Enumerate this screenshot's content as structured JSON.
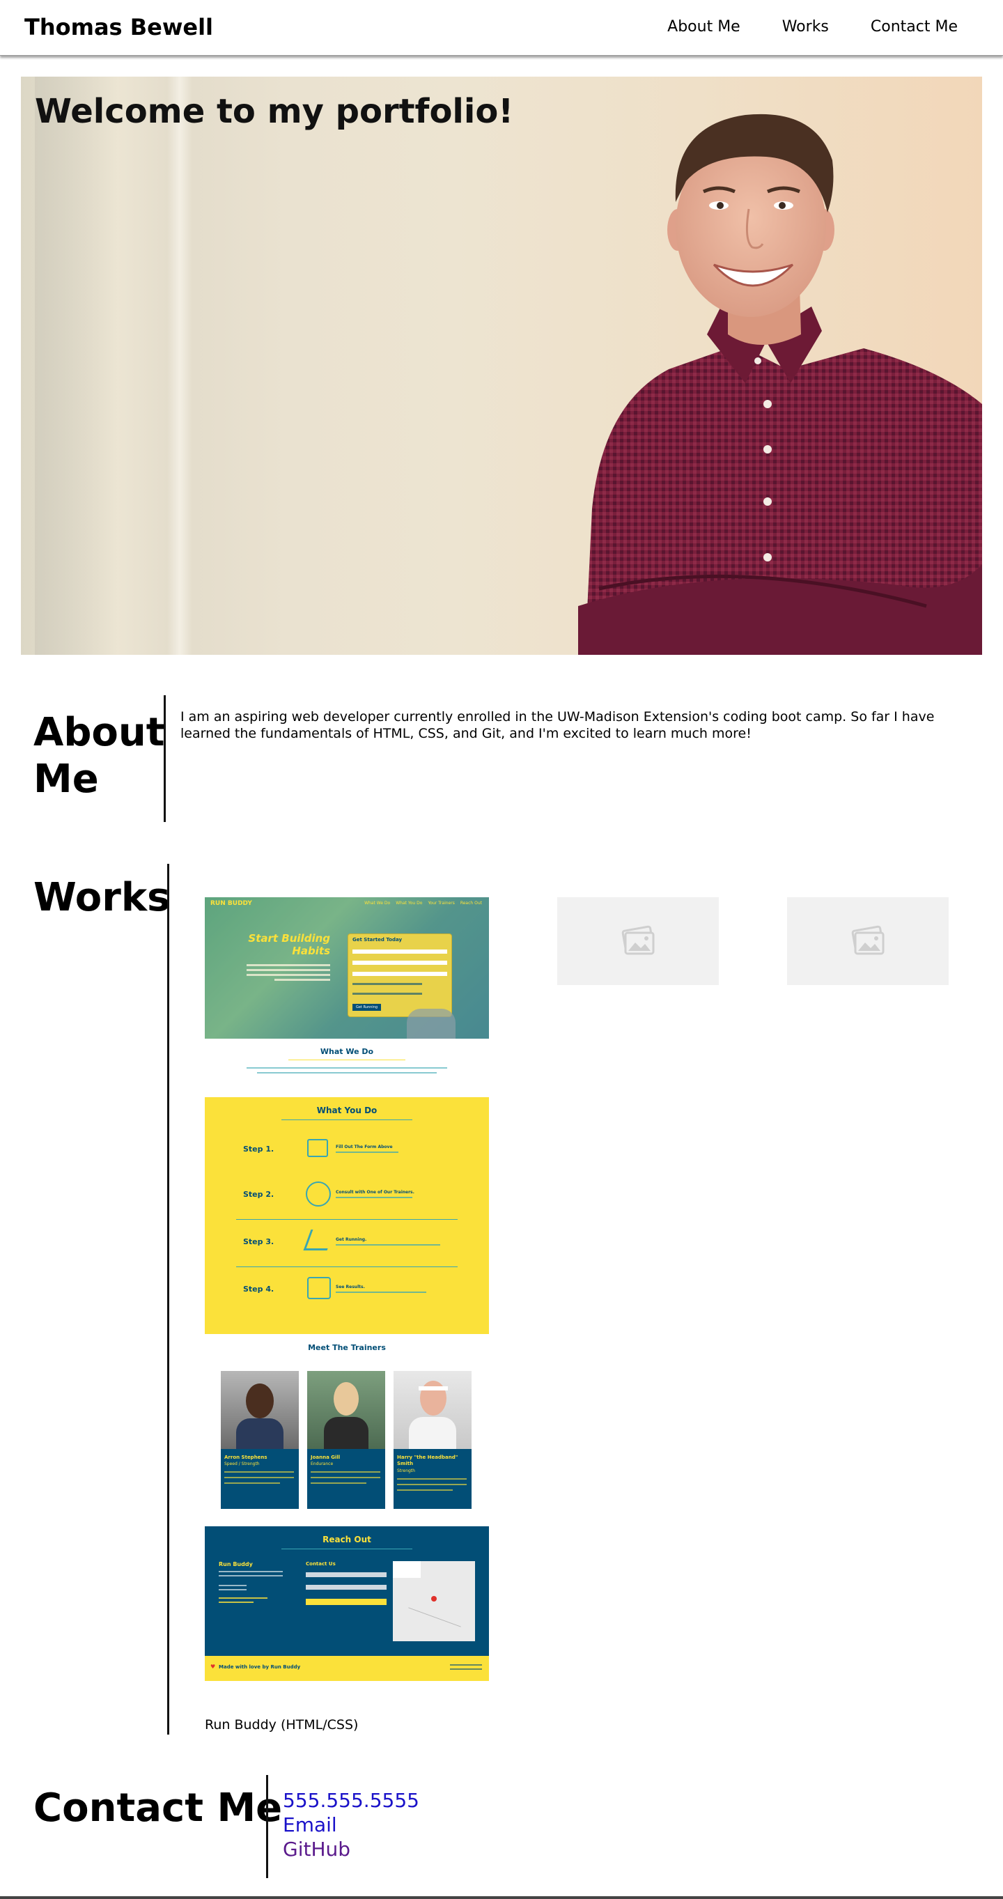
{
  "header": {
    "brand": "Thomas Bewell",
    "nav": [
      "About Me",
      "Works",
      "Contact Me"
    ]
  },
  "hero": {
    "title": "Welcome to my portfolio!"
  },
  "about": {
    "title_line1": "About",
    "title_line2": "Me",
    "text": "I am an aspiring web developer currently enrolled in the UW-Madison Extension's coding boot camp. So far I have learned the fundamentals of HTML, CSS, and Git, and I'm excited to learn much more!"
  },
  "works": {
    "title": "Works",
    "caption": "Run Buddy (HTML/CSS)",
    "screenshot": {
      "logo": "RUN BUDDY",
      "nav": [
        "What We Do",
        "What You Do",
        "Your Trainers",
        "Reach Out"
      ],
      "hero_heading_1": "Start Building",
      "hero_heading_2": "Habits",
      "form_title": "Get Started Today",
      "form_button": "Get Running",
      "what_we_do": "What We Do",
      "what_you_do": "What You Do",
      "steps": [
        {
          "label": "Step 1.",
          "title": "Fill Out The Form Above"
        },
        {
          "label": "Step 2.",
          "title": "Consult with One of Our Trainers."
        },
        {
          "label": "Step 3.",
          "title": "Get Running."
        },
        {
          "label": "Step 4.",
          "title": "See Results."
        }
      ],
      "trainers_title": "Meet The Trainers",
      "trainers": [
        {
          "name": "Arron Stephens",
          "role": "Speed / Strength"
        },
        {
          "name": "Joanna Gill",
          "role": "Endurance"
        },
        {
          "name": "Harry \"the Headband\" Smith",
          "role": "Strength"
        }
      ],
      "reach_out": "Reach Out",
      "reach_brand": "Run Buddy",
      "contact_us": "Contact Us",
      "footer_text": "Made with love by Run Buddy"
    }
  },
  "contact": {
    "title": "Contact Me",
    "phone": "555.555.5555",
    "email": "Email",
    "github": "GitHub"
  },
  "colors": {
    "link": "#1a12c9",
    "visited": "#5a1a8c",
    "rb_yellow": "#fbe13a",
    "rb_navy": "#024e76",
    "rb_teal": "#39a6b2"
  }
}
